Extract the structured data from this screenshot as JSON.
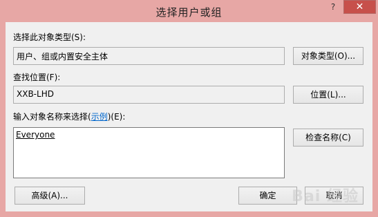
{
  "window": {
    "title": "选择用户或组",
    "help_label": "?",
    "close_label": "✕"
  },
  "object_type": {
    "label": "选择此对象类型(S):",
    "value": "用户、组或内置安全主体",
    "button": "对象类型(O)..."
  },
  "location": {
    "label": "查找位置(F):",
    "value": "XXB-LHD",
    "button": "位置(L)..."
  },
  "names": {
    "label_prefix": "输入对象名称来选择(",
    "label_link": "示例",
    "label_suffix": ")(E):",
    "value": "Everyone",
    "check_button": "检查名称(C)"
  },
  "footer": {
    "advanced_button": "高级(A)...",
    "ok_button": "确定",
    "cancel_button": "取消"
  },
  "watermark": {
    "text": "Bai 经验"
  },
  "colors": {
    "frame": "#e7a7a5",
    "close_button": "#c7504b",
    "client_bg": "#f0f0f0"
  }
}
